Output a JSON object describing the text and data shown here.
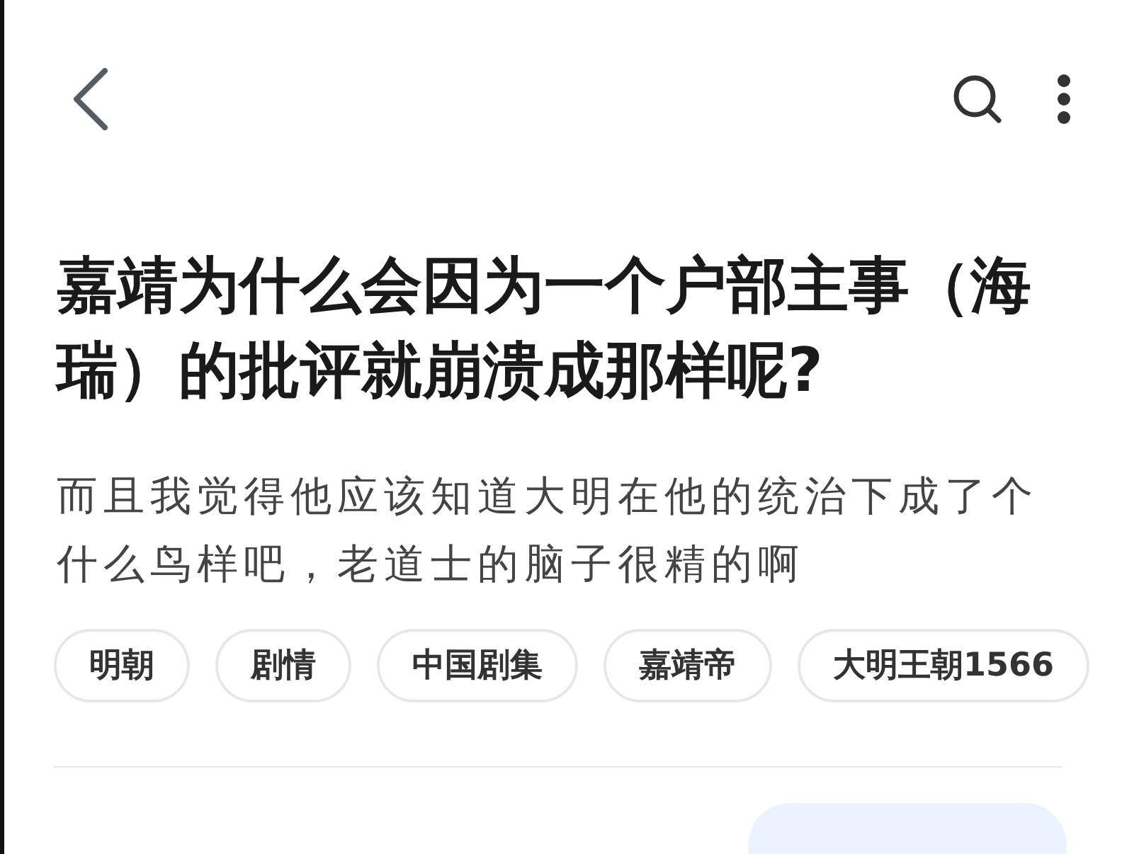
{
  "title": "嘉靖为什么会因为一个户部主事（海瑞）的批评就崩溃成那样呢?",
  "description": "而且我觉得他应该知道大明在他的统治下成了个什么鸟样吧，老道士的脑子很精的啊",
  "tags": [
    "明朝",
    "剧情",
    "中国剧集",
    "嘉靖帝",
    "大明王朝1566"
  ]
}
